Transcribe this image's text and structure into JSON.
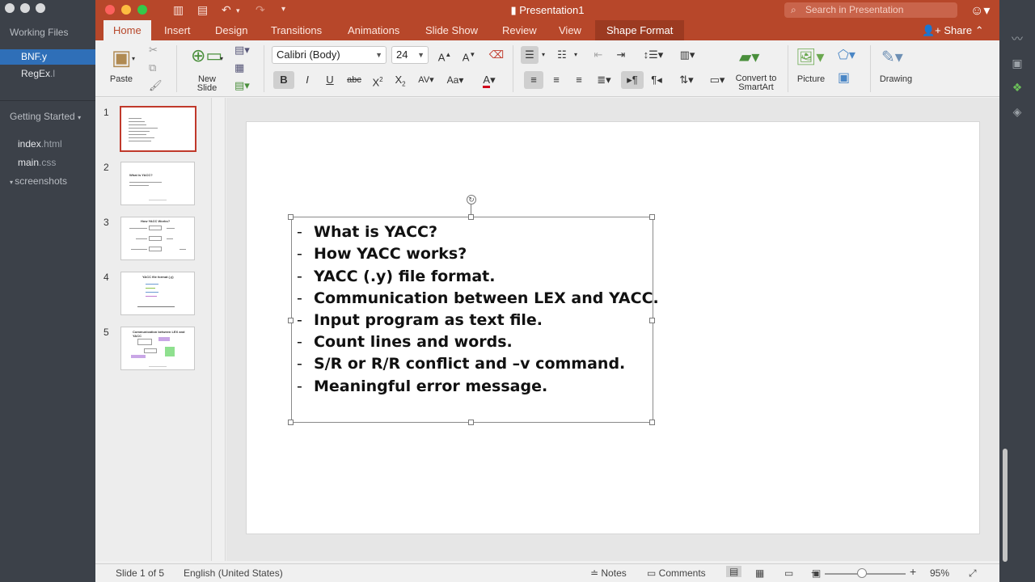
{
  "sidebar": {
    "working_files_label": "Working Files",
    "working_files": [
      {
        "name": "BNF",
        "ext": ".y",
        "active": true
      },
      {
        "name": "RegEx",
        "ext": ".l",
        "active": false
      }
    ],
    "project_label": "Getting Started",
    "project_files": [
      {
        "name": "index",
        "ext": ".html"
      },
      {
        "name": "main",
        "ext": ".css"
      },
      {
        "name": "screenshots",
        "ext": ""
      }
    ]
  },
  "window": {
    "title": "Presentation1",
    "search_placeholder": "Search in Presentation",
    "share_label": "Share"
  },
  "tabs": [
    "Home",
    "Insert",
    "Design",
    "Transitions",
    "Animations",
    "Slide Show",
    "Review",
    "View",
    "Shape Format"
  ],
  "ribbon": {
    "paste_label": "Paste",
    "new_slide_label_1": "New",
    "new_slide_label_2": "Slide",
    "font_name": "Calibri (Body)",
    "font_size": "24",
    "convert_label_1": "Convert to",
    "convert_label_2": "SmartArt",
    "picture_label": "Picture",
    "drawing_label": "Drawing",
    "bold": "B",
    "italic": "I",
    "underline": "U",
    "strike": "abc"
  },
  "slides": {
    "count_numbers": [
      "1",
      "2",
      "3",
      "4",
      "5"
    ],
    "thumb2_title": "What is YACC?",
    "thumb3_title": "How YACC Works?",
    "thumb4_title": "YACC file format (.y)",
    "thumb5_title": "Communication between LEX and YACC"
  },
  "slide": {
    "bullets": [
      "What is YACC?",
      "How YACC works?",
      "YACC (.y) file format.",
      "Communication between LEX and YACC.",
      "Input program as text file.",
      "Count lines and words.",
      "S/R or R/R conflict and –v command.",
      "Meaningful error message."
    ]
  },
  "status": {
    "slide_info": "Slide 1 of 5",
    "language": "English (United States)",
    "notes_label": "Notes",
    "comments_label": "Comments",
    "zoom": "95%"
  },
  "colors": {
    "accent": "#b7472a",
    "selected_file": "#2f6fb8"
  }
}
